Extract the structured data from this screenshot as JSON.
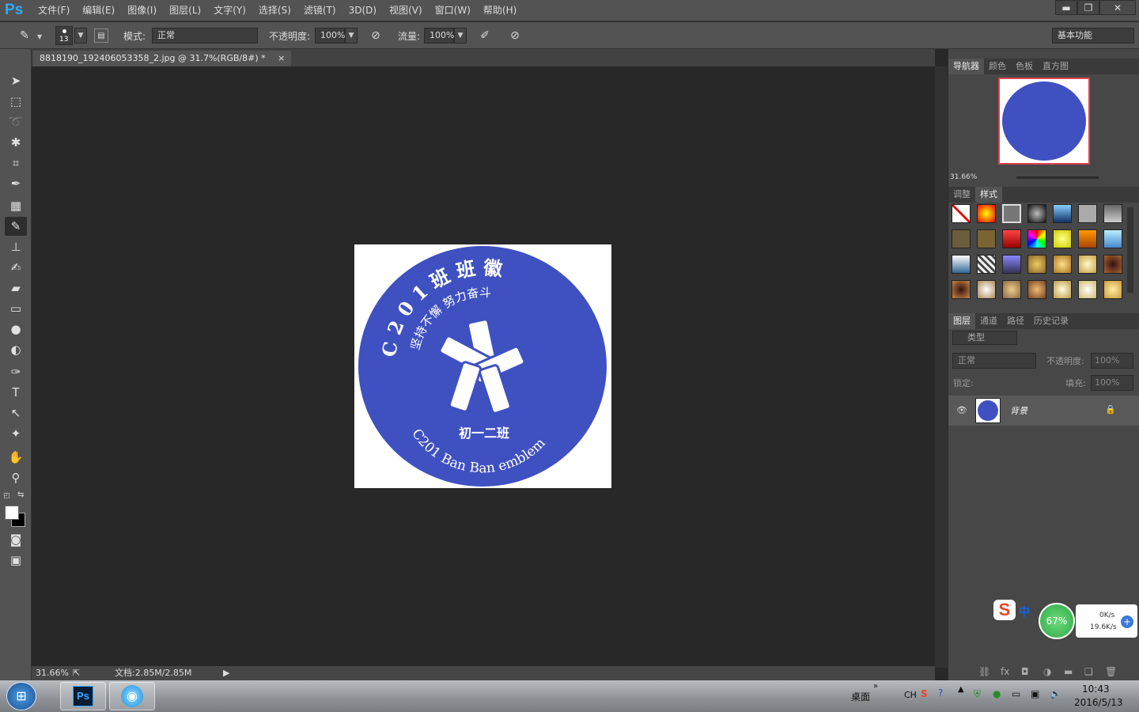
{
  "app": {
    "logo": "Ps",
    "menus": [
      "文件(F)",
      "编辑(E)",
      "图像(I)",
      "图层(L)",
      "文字(Y)",
      "选择(S)",
      "滤镜(T)",
      "3D(D)",
      "视图(V)",
      "窗口(W)",
      "帮助(H)"
    ],
    "win_min": "▬",
    "win_max": "❐",
    "win_close": "✕"
  },
  "options": {
    "brush_size": "13",
    "mode_label": "模式:",
    "mode_value": "正常",
    "opacity_label": "不透明度:",
    "opacity_value": "100%",
    "flow_label": "流量:",
    "flow_value": "100%",
    "workspace": "基本功能"
  },
  "document": {
    "tab_title": "8818190_192406053358_2.jpg @ 31.7%(RGB/8#) *",
    "tab_close": "×",
    "zoom": "31.66%",
    "doc_size": "文档:2.85M/2.85M"
  },
  "emblem": {
    "top_text": "C 2 0 1 班 班 徽",
    "motto": "坚持不懈 努力奋斗",
    "class_name": "初一二班",
    "bottom_text": "C201 Ban Ban emblem",
    "bg_color": "#3f51c0"
  },
  "navigator": {
    "tabs": [
      "导航器",
      "颜色",
      "色板",
      "直方图"
    ],
    "zoom": "31.66%"
  },
  "styles": {
    "tabs": [
      "调整",
      "样式"
    ]
  },
  "layers": {
    "tabs": [
      "图层",
      "通道",
      "路径",
      "历史记录"
    ],
    "filter": "类型",
    "blend": "正常",
    "opacity_label": "不透明度:",
    "opacity_value": "100%",
    "lock_label": "锁定:",
    "fill_label": "填充:",
    "fill_value": "100%",
    "layer_name": "背景"
  },
  "ime": {
    "label": "中",
    "net_pct": "67%",
    "up": "0K/s",
    "down": "19.6K/s"
  },
  "taskbar": {
    "desktop": "桌面",
    "lang": "CH",
    "time": "10:43",
    "date": "2016/5/13"
  }
}
